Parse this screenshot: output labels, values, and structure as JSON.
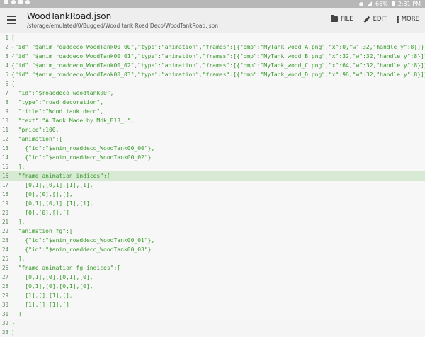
{
  "status_bar": {
    "battery_percent": "66%",
    "time": "2:31 PM"
  },
  "app_bar": {
    "title": "WoodTankRoad.json",
    "subtitle": "/storage/emulated/0/Bugged/Wood tank Road Deco/WoodTankRoad.json",
    "actions": [
      {
        "label": "FILE",
        "icon": "folder-icon"
      },
      {
        "label": "EDIT",
        "icon": "pencil-icon"
      },
      {
        "label": "MORE",
        "icon": "more-vert-icon"
      }
    ]
  },
  "editor": {
    "highlighted_line": 16,
    "lines": [
      {
        "n": "1",
        "text": "["
      },
      {
        "n": "2",
        "text": "{\"id\":\"$anim_roaddeco_WoodTank00_00\",\"type\":\"animation\",\"frames\":[{\"bmp\":\"MyTank_wood_A.png\",\"x\":0,\"w\":32,\"handle y\":8}]},"
      },
      {
        "n": "3",
        "text": "{\"id\":\"$anim_roaddeco_WoodTank00_01\",\"type\":\"animation\",\"frames\":[{\"bmp\":\"MyTank_wood_B.png\",\"x\":32,\"w\":32,\"handle y\":8}]},"
      },
      {
        "n": "4",
        "text": "{\"id\":\"$anim_roaddeco_WoodTank00_02\",\"type\":\"animation\",\"frames\":[{\"bmp\":\"MyTank_wood_C.png\",\"x\":64,\"w\":32,\"handle y\":8}]},"
      },
      {
        "n": "5",
        "text": "{\"id\":\"$anim_roaddeco_WoodTank00_03\",\"type\":\"animation\",\"frames\":[{\"bmp\":\"MyTank_wood_D.png\",\"x\":96,\"w\":32,\"handle y\":8}]},"
      },
      {
        "n": "6",
        "text": "{"
      },
      {
        "n": "7",
        "text": "  \"id\":\"$roaddeco_woodtank00\","
      },
      {
        "n": "8",
        "text": "  \"type\":\"road decoration\","
      },
      {
        "n": "9",
        "text": "  \"title\":\"Wood tank deco\","
      },
      {
        "n": "10",
        "text": "  \"text\":\"A Tank Made by Mdk_B13_.\","
      },
      {
        "n": "11",
        "text": "  \"price\":100,"
      },
      {
        "n": "12",
        "text": "  \"animation\":["
      },
      {
        "n": "13",
        "text": "    {\"id\":\"$anim_roaddeco_WoodTank00_00\"},"
      },
      {
        "n": "14",
        "text": "    {\"id\":\"$anim_roaddeco_WoodTank00_02\"}"
      },
      {
        "n": "15",
        "text": "  ],"
      },
      {
        "n": "16",
        "text": "  \"frame animation indices\":["
      },
      {
        "n": "17",
        "text": "    [0,1],[0,1],[1],[1],"
      },
      {
        "n": "18",
        "text": "    [0],[0],[],[],"
      },
      {
        "n": "19",
        "text": "    [0,1],[0,1],[1],[1],"
      },
      {
        "n": "20",
        "text": "    [0],[0],[],[]"
      },
      {
        "n": "21",
        "text": "  ],"
      },
      {
        "n": "22",
        "text": "  \"animation fg\":["
      },
      {
        "n": "23",
        "text": "    {\"id\":\"$anim_roaddeco_WoodTank00_01\"},"
      },
      {
        "n": "24",
        "text": "    {\"id\":\"$anim_roaddeco_WoodTank00_03\"}"
      },
      {
        "n": "25",
        "text": "  ],"
      },
      {
        "n": "26",
        "text": "  \"frame animation fg indices\":["
      },
      {
        "n": "27",
        "text": "    [0,1],[0],[0,1],[0],"
      },
      {
        "n": "28",
        "text": "    [0,1],[0],[0,1],[0],"
      },
      {
        "n": "29",
        "text": "    [1],[],[1],[],"
      },
      {
        "n": "30",
        "text": "    [1],[],[1],[]"
      },
      {
        "n": "31",
        "text": "  ]"
      },
      {
        "n": "32",
        "text": "}"
      },
      {
        "n": "33",
        "text": "]"
      }
    ]
  },
  "colors": {
    "code_text": "#3a9a2d",
    "line_number": "#5e8b5c",
    "highlight": "#d8e9d4",
    "status_bar": "#b7b7b7"
  }
}
